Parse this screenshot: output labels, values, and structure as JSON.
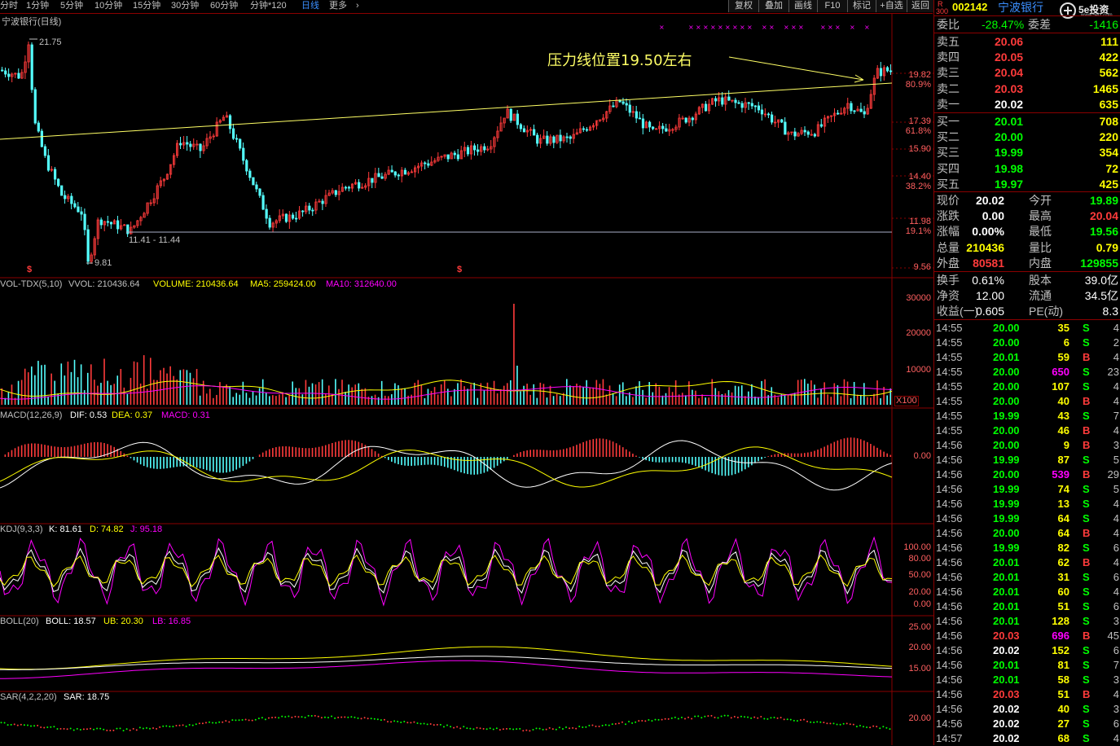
{
  "toolbar": {
    "periods": [
      "分时",
      "1分钟",
      "5分钟",
      "10分钟",
      "15分钟",
      "30分钟",
      "60分钟",
      "分钟*120",
      "日线",
      "更多",
      "›"
    ],
    "active_period": "日线",
    "buttons": [
      "复权",
      "叠加",
      "画线",
      "F10",
      "标记",
      "+自选",
      "返回"
    ]
  },
  "stock": {
    "code": "002142",
    "name": "宁波银行",
    "chart_title": "宁波银行(日线)",
    "pin_r": "R",
    "pin_num": "300"
  },
  "logo": {
    "text": "5e投资",
    "sub": "www.5etz.com"
  },
  "price_chart": {
    "axis_labels": [
      "19.82",
      "80.9%",
      "17.39",
      "61.8%",
      "15.90",
      "14.40",
      "38.2%",
      "11.98",
      "19.1%",
      "9.56"
    ],
    "high_label": "21.75",
    "low_label": "9.81",
    "support_label": "11.41 - 11.44",
    "annotation": "压力线位置19.50左右",
    "markers": [
      "$",
      "$"
    ]
  },
  "vol_panel": {
    "indicator": "VOL-TDX(5,10)",
    "vvol": "VVOL: 210436.64",
    "volume": "VOLUME: 210436.64",
    "ma5": "MA5: 259424.00",
    "ma10": "MA10: 312640.00",
    "axis": [
      "30000",
      "20000",
      "10000"
    ],
    "unit": "X100"
  },
  "macd_panel": {
    "indicator": "MACD(12,26,9)",
    "dif": "DIF: 0.53",
    "dea": "DEA: 0.37",
    "macd": "MACD: 0.31",
    "axis": [
      "0.00"
    ]
  },
  "kdj_panel": {
    "indicator": "KDJ(9,3,3)",
    "k": "K: 81.61",
    "d": "D: 74.82",
    "j": "J: 95.18",
    "axis": [
      "100.00",
      "80.00",
      "50.00",
      "20.00",
      "0.00"
    ]
  },
  "boll_panel": {
    "indicator": "BOLL(20)",
    "boll": "BOLL: 18.57",
    "ub": "UB: 20.30",
    "lb": "LB: 16.85",
    "axis": [
      "25.00",
      "20.00",
      "15.00"
    ]
  },
  "sar_panel": {
    "indicator": "SAR(4,2,2,20)",
    "sar": "SAR: 18.75",
    "axis": [
      "20.00"
    ]
  },
  "quote": {
    "weibi_label": "委比",
    "weibi": "-28.47%",
    "weicha_label": "委差",
    "weicha": "-1416",
    "asks": [
      {
        "label": "卖五",
        "price": "20.06",
        "vol": "111"
      },
      {
        "label": "卖四",
        "price": "20.05",
        "vol": "422"
      },
      {
        "label": "卖三",
        "price": "20.04",
        "vol": "562"
      },
      {
        "label": "卖二",
        "price": "20.03",
        "vol": "1465"
      },
      {
        "label": "卖一",
        "price": "20.02",
        "vol": "635"
      }
    ],
    "bids": [
      {
        "label": "买一",
        "price": "20.01",
        "vol": "708"
      },
      {
        "label": "买二",
        "price": "20.00",
        "vol": "220"
      },
      {
        "label": "买三",
        "price": "19.99",
        "vol": "354"
      },
      {
        "label": "买四",
        "price": "19.98",
        "vol": "72"
      },
      {
        "label": "买五",
        "price": "19.97",
        "vol": "425"
      }
    ],
    "stats": [
      {
        "l1": "现价",
        "v1": "20.02",
        "l2": "今开",
        "v2": "19.89"
      },
      {
        "l1": "涨跌",
        "v1": "0.00",
        "l2": "最高",
        "v2": "20.04"
      },
      {
        "l1": "涨幅",
        "v1": "0.00%",
        "l2": "最低",
        "v2": "19.56"
      },
      {
        "l1": "总量",
        "v1": "210436",
        "l2": "量比",
        "v2": "0.79"
      },
      {
        "l1": "外盘",
        "v1": "80581",
        "l2": "内盘",
        "v2": "129855"
      }
    ],
    "stats2": [
      {
        "l1": "换手",
        "v1": "0.61%",
        "l2": "股本",
        "v2": "39.0亿"
      },
      {
        "l1": "净资",
        "v1": "12.00",
        "l2": "流通",
        "v2": "34.5亿"
      },
      {
        "l1": "收益(一)",
        "v1": "0.605",
        "l2": "PE(动)",
        "v2": "8.3"
      }
    ]
  },
  "ticks": [
    {
      "time": "14:55",
      "price": "20.00",
      "vol": "35",
      "bs": "S",
      "n": "4"
    },
    {
      "time": "14:55",
      "price": "20.00",
      "vol": "6",
      "bs": "S",
      "n": "2"
    },
    {
      "time": "14:55",
      "price": "20.01",
      "vol": "59",
      "bs": "B",
      "n": "4"
    },
    {
      "time": "14:55",
      "price": "20.00",
      "vol": "650",
      "bs": "S",
      "n": "23"
    },
    {
      "time": "14:55",
      "price": "20.00",
      "vol": "107",
      "bs": "S",
      "n": "4"
    },
    {
      "time": "14:55",
      "price": "20.00",
      "vol": "40",
      "bs": "B",
      "n": "4"
    },
    {
      "time": "14:55",
      "price": "19.99",
      "vol": "43",
      "bs": "S",
      "n": "7"
    },
    {
      "time": "14:55",
      "price": "20.00",
      "vol": "46",
      "bs": "B",
      "n": "4"
    },
    {
      "time": "14:56",
      "price": "20.00",
      "vol": "9",
      "bs": "B",
      "n": "3"
    },
    {
      "time": "14:56",
      "price": "19.99",
      "vol": "87",
      "bs": "S",
      "n": "5"
    },
    {
      "time": "14:56",
      "price": "20.00",
      "vol": "539",
      "bs": "B",
      "n": "29"
    },
    {
      "time": "14:56",
      "price": "19.99",
      "vol": "74",
      "bs": "S",
      "n": "5"
    },
    {
      "time": "14:56",
      "price": "19.99",
      "vol": "13",
      "bs": "S",
      "n": "4"
    },
    {
      "time": "14:56",
      "price": "19.99",
      "vol": "64",
      "bs": "S",
      "n": "4"
    },
    {
      "time": "14:56",
      "price": "20.00",
      "vol": "64",
      "bs": "B",
      "n": "4"
    },
    {
      "time": "14:56",
      "price": "19.99",
      "vol": "82",
      "bs": "S",
      "n": "6"
    },
    {
      "time": "14:56",
      "price": "20.01",
      "vol": "62",
      "bs": "B",
      "n": "4"
    },
    {
      "time": "14:56",
      "price": "20.01",
      "vol": "31",
      "bs": "S",
      "n": "6"
    },
    {
      "time": "14:56",
      "price": "20.01",
      "vol": "60",
      "bs": "S",
      "n": "4"
    },
    {
      "time": "14:56",
      "price": "20.01",
      "vol": "51",
      "bs": "S",
      "n": "6"
    },
    {
      "time": "14:56",
      "price": "20.01",
      "vol": "128",
      "bs": "S",
      "n": "3"
    },
    {
      "time": "14:56",
      "price": "20.03",
      "vol": "696",
      "bs": "B",
      "n": "45"
    },
    {
      "time": "14:56",
      "price": "20.02",
      "vol": "152",
      "bs": "S",
      "n": "6"
    },
    {
      "time": "14:56",
      "price": "20.01",
      "vol": "81",
      "bs": "S",
      "n": "7"
    },
    {
      "time": "14:56",
      "price": "20.01",
      "vol": "58",
      "bs": "S",
      "n": "3"
    },
    {
      "time": "14:56",
      "price": "20.03",
      "vol": "51",
      "bs": "B",
      "n": "4"
    },
    {
      "time": "14:56",
      "price": "20.02",
      "vol": "40",
      "bs": "S",
      "n": "3"
    },
    {
      "time": "14:56",
      "price": "20.02",
      "vol": "27",
      "bs": "S",
      "n": "6"
    },
    {
      "time": "14:57",
      "price": "20.02",
      "vol": "68",
      "bs": "S",
      "n": "4"
    }
  ],
  "colors": {
    "up": "#ff3b3b",
    "down": "#54ffff",
    "ma_yellow": "#ffff00",
    "magenta": "#ff00ff",
    "white": "#ffffff",
    "grid": "#8b0000",
    "green": "#00ff00"
  }
}
